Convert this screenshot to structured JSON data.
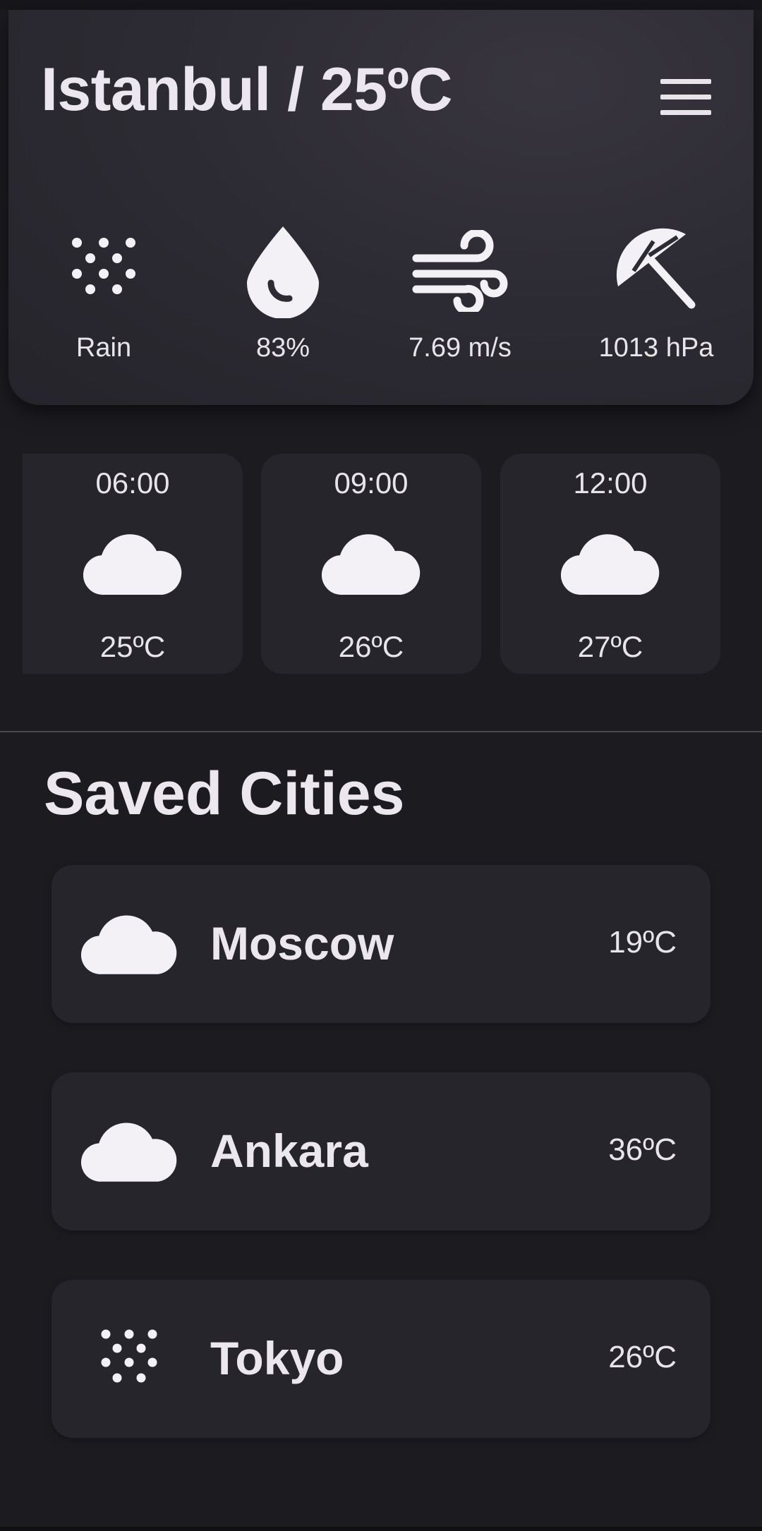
{
  "header": {
    "title": "Istanbul / 25ºC",
    "menu_icon": "hamburger-menu-icon"
  },
  "metrics": [
    {
      "icon": "rain-icon",
      "label": "Rain"
    },
    {
      "icon": "humidity-drop-icon",
      "label": "83%"
    },
    {
      "icon": "wind-icon",
      "label": "7.69 m/s"
    },
    {
      "icon": "umbrella-pressure-icon",
      "label": "1013 hPa"
    }
  ],
  "hourly": [
    {
      "time": "06:00",
      "icon": "cloud-icon",
      "temp": "25ºC"
    },
    {
      "time": "09:00",
      "icon": "cloud-icon",
      "temp": "26ºC"
    },
    {
      "time": "12:00",
      "icon": "cloud-icon",
      "temp": "27ºC"
    }
  ],
  "saved": {
    "title": "Saved Cities",
    "cities": [
      {
        "name": "Moscow",
        "temp": "19ºC",
        "icon": "cloud-icon"
      },
      {
        "name": "Ankara",
        "temp": "36ºC",
        "icon": "cloud-icon"
      },
      {
        "name": "Tokyo",
        "temp": "26ºC",
        "icon": "rain-icon"
      }
    ]
  },
  "colors": {
    "background": "#1c1b20",
    "header_card": "#2d2b33",
    "card": "#26252b",
    "text": "#e8e4ea"
  }
}
